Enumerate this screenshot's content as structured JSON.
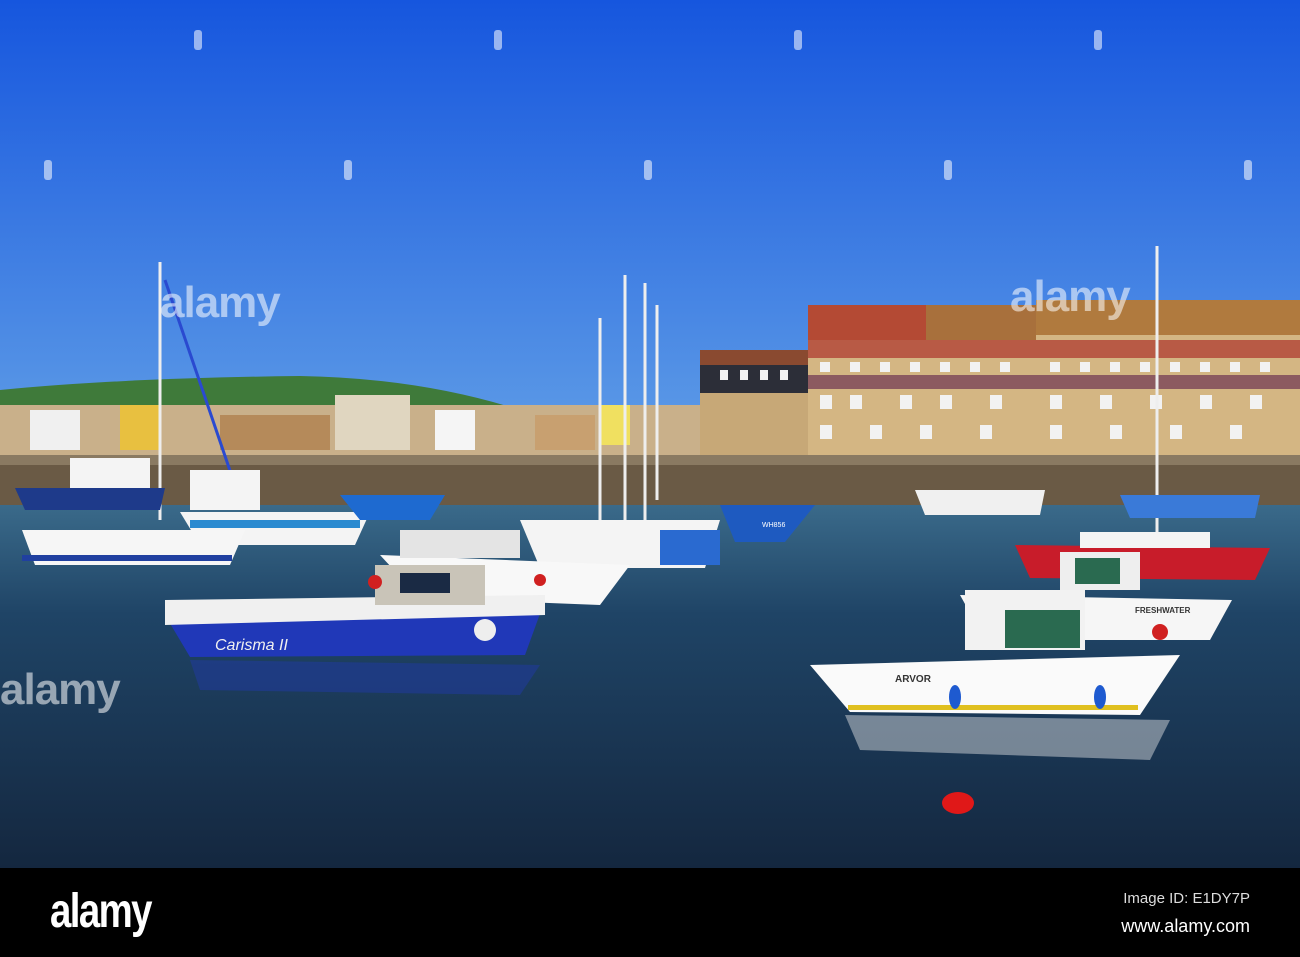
{
  "photo": {
    "subject": "harbour-with-moored-boats",
    "boat_names": [
      "Carisma II",
      "ARVOR",
      "FRESHWATER",
      "WH856"
    ]
  },
  "watermark": {
    "text": "alamy"
  },
  "footer": {
    "logo": "alamy",
    "image_id": "Image ID: E1DY7P",
    "website": "www.alamy.com"
  },
  "colors": {
    "sky_top": "#1a5fe0",
    "sky_bottom": "#4a8fe8",
    "water": "#1c3a60",
    "footer": "#000000"
  }
}
